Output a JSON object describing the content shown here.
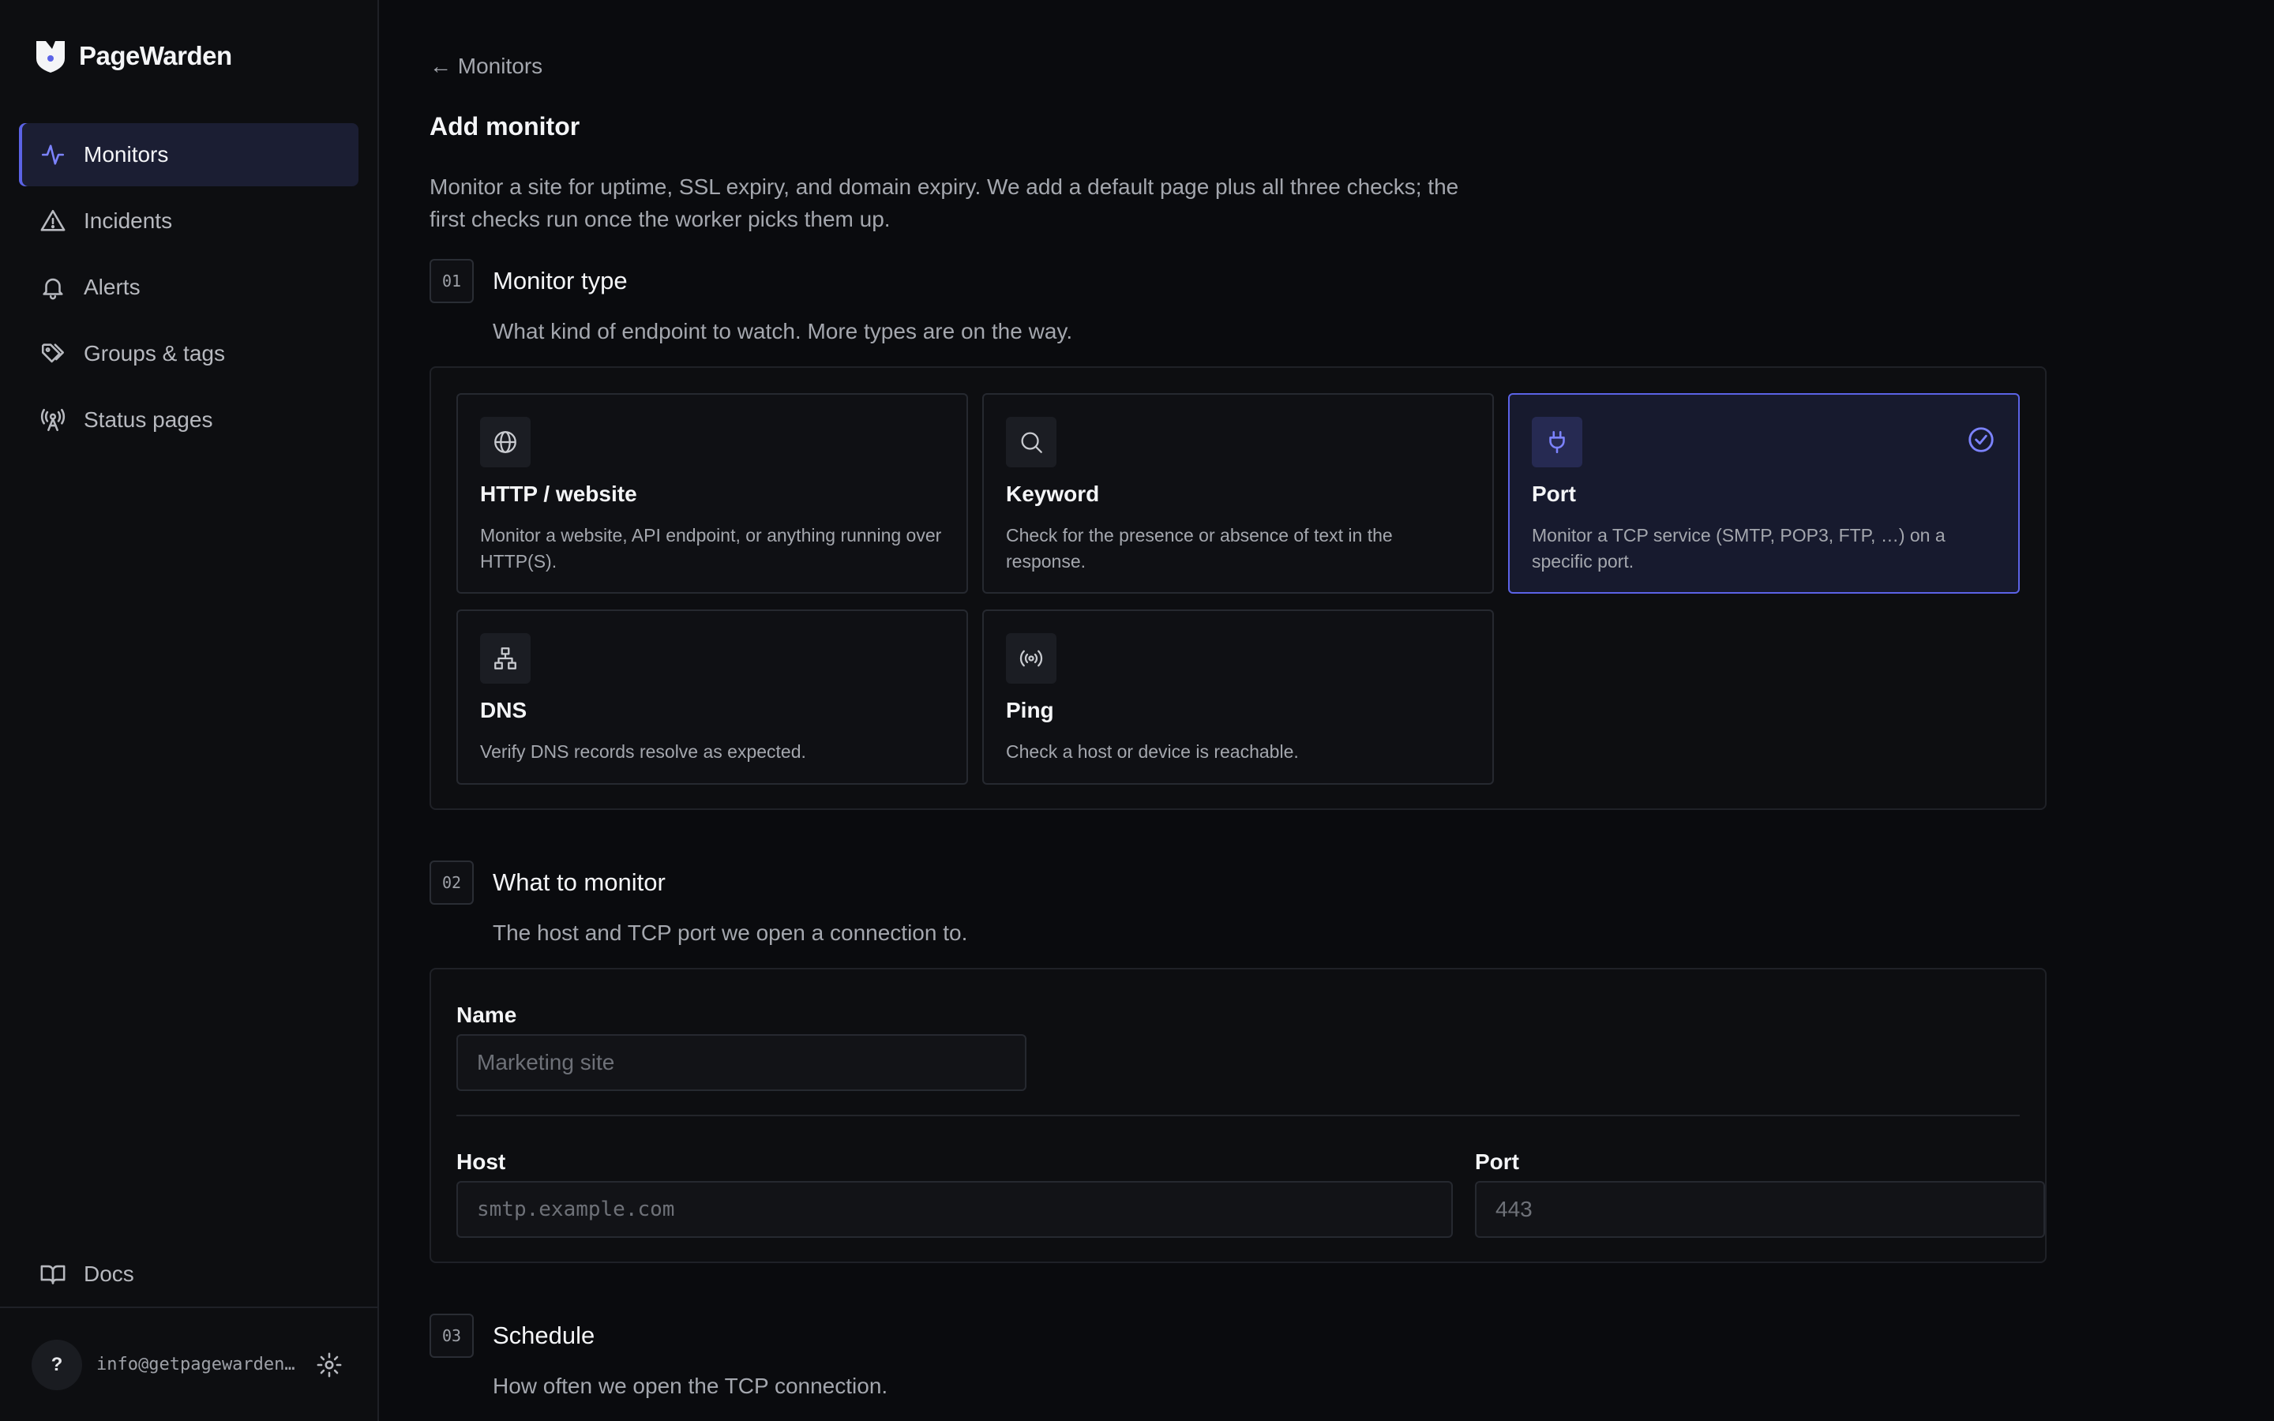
{
  "brand": {
    "name": "PageWarden"
  },
  "sidebar": {
    "items": [
      {
        "label": "Monitors",
        "icon": "activity-icon",
        "active": true
      },
      {
        "label": "Incidents",
        "icon": "alert-triangle-icon"
      },
      {
        "label": "Alerts",
        "icon": "bell-icon"
      },
      {
        "label": "Groups & tags",
        "icon": "tags-icon"
      },
      {
        "label": "Status pages",
        "icon": "radio-tower-icon"
      }
    ],
    "docs": {
      "label": "Docs",
      "icon": "book-icon"
    },
    "footer": {
      "help": "?",
      "email": "info@getpagewarden.com"
    }
  },
  "main": {
    "back": "← Monitors",
    "title": "Add monitor",
    "description": "Monitor a site for uptime, SSL expiry, and domain expiry. We add a default page plus all three checks; the first checks run once the worker picks them up.",
    "steps": [
      {
        "num": "01",
        "title": "Monitor type",
        "subtitle": "What kind of endpoint to watch. More types are on the way."
      },
      {
        "num": "02",
        "title": "What to monitor",
        "subtitle": "The host and TCP port we open a connection to."
      },
      {
        "num": "03",
        "title": "Schedule",
        "subtitle": "How often we open the TCP connection."
      }
    ],
    "types": [
      {
        "name": "HTTP / website",
        "desc": "Monitor a website, API endpoint, or anything running over HTTP(S).",
        "icon": "globe-icon"
      },
      {
        "name": "Keyword",
        "desc": "Check for the presence or absence of text in the response.",
        "icon": "search-icon"
      },
      {
        "name": "Port",
        "desc": "Monitor a TCP service (SMTP, POP3, FTP, …) on a specific port.",
        "icon": "plug-icon",
        "selected": true
      },
      {
        "name": "DNS",
        "desc": "Verify DNS records resolve as expected.",
        "icon": "network-icon"
      },
      {
        "name": "Ping",
        "desc": "Check a host or device is reachable.",
        "icon": "radio-icon"
      }
    ],
    "form": {
      "name_label": "Name",
      "name_placeholder": "Marketing site",
      "host_label": "Host",
      "host_placeholder": "smtp.example.com",
      "port_label": "Port",
      "port_placeholder": "443"
    }
  },
  "colors": {
    "accent": "#5b63e6",
    "background": "#0a0b0e",
    "panel": "#0d0e11"
  }
}
